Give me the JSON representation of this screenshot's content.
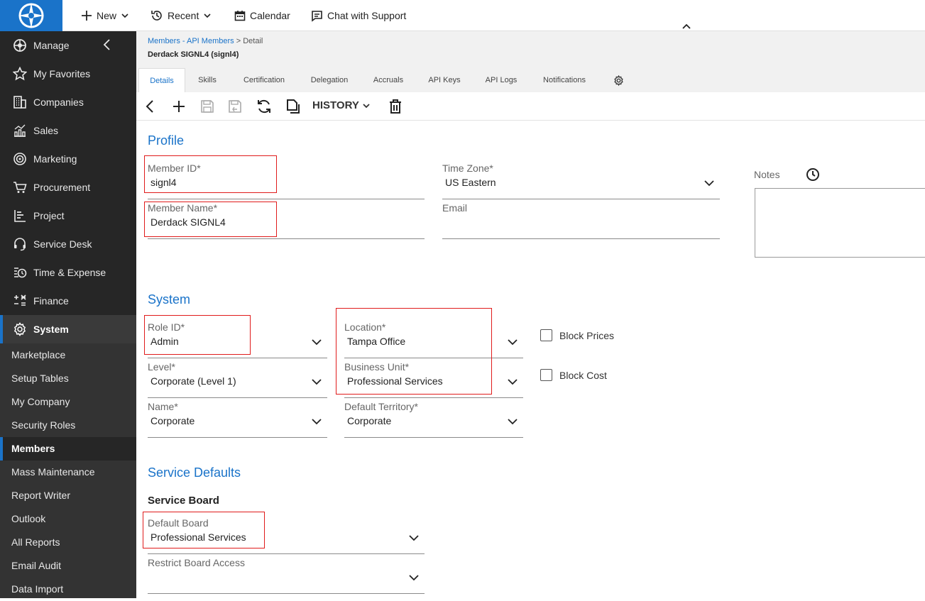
{
  "topbar": {
    "new_label": "New",
    "recent_label": "Recent",
    "calendar_label": "Calendar",
    "chat_label": "Chat with Support"
  },
  "sidebar": {
    "items": [
      {
        "label": "Manage",
        "icon": "compass-icon"
      },
      {
        "label": "My Favorites",
        "icon": "star-icon"
      },
      {
        "label": "Companies",
        "icon": "building-icon"
      },
      {
        "label": "Sales",
        "icon": "chart-icon"
      },
      {
        "label": "Marketing",
        "icon": "target-icon"
      },
      {
        "label": "Procurement",
        "icon": "cart-icon"
      },
      {
        "label": "Project",
        "icon": "project-icon"
      },
      {
        "label": "Service Desk",
        "icon": "headset-icon"
      },
      {
        "label": "Time & Expense",
        "icon": "clock-icon"
      },
      {
        "label": "Finance",
        "icon": "calculator-icon"
      },
      {
        "label": "System",
        "icon": "gear-icon"
      }
    ],
    "sub_items": [
      "Marketplace",
      "Setup Tables",
      "My Company",
      "Security Roles",
      "Members",
      "Mass Maintenance",
      "Report Writer",
      "Outlook",
      "All Reports",
      "Email Audit",
      "Data Import"
    ]
  },
  "header": {
    "breadcrumb_link": "Members - API Members",
    "breadcrumb_sep": ">",
    "breadcrumb_current": "Detail",
    "record_title": "Derdack SIGNL4 (signl4)",
    "tabs": [
      "Details",
      "Skills",
      "Certification",
      "Delegation",
      "Accruals",
      "API Keys",
      "API Logs",
      "Notifications"
    ]
  },
  "toolbar": {
    "history_label": "HISTORY"
  },
  "profile": {
    "title": "Profile",
    "member_id_label": "Member ID*",
    "member_id": "signl4",
    "member_name_label": "Member Name*",
    "member_name": "Derdack SIGNL4",
    "time_zone_label": "Time Zone*",
    "time_zone": "US Eastern",
    "email_label": "Email",
    "email": "",
    "notes_label": "Notes"
  },
  "system": {
    "title": "System",
    "role_label": "Role ID*",
    "role": "Admin",
    "level_label": "Level*",
    "level": "Corporate (Level 1)",
    "name_label": "Name*",
    "name": "Corporate",
    "location_label": "Location*",
    "location": "Tampa Office",
    "business_unit_label": "Business Unit*",
    "business_unit": "Professional Services",
    "territory_label": "Default Territory*",
    "territory": "Corporate",
    "block_prices_label": "Block Prices",
    "block_cost_label": "Block Cost"
  },
  "service_defaults": {
    "title": "Service Defaults",
    "service_board_title": "Service Board",
    "default_board_label": "Default Board",
    "default_board": "Professional Services",
    "restrict_label": "Restrict Board Access",
    "restrict": ""
  },
  "colors": {
    "accent": "#1a73c9",
    "sidebar": "#262626",
    "highlight": "#e01b1b"
  }
}
